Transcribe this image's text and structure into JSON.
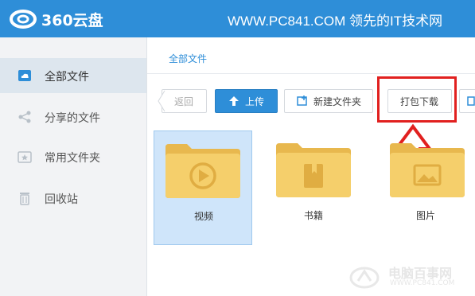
{
  "header": {
    "app_name": "360云盘",
    "watermark": "WWW.PC841.COM 领先的IT技术网",
    "bg_color": "#2e8ed8"
  },
  "sidebar": {
    "items": [
      {
        "label": "全部文件",
        "icon": "cloud-icon",
        "active": true
      },
      {
        "label": "分享的文件",
        "icon": "share-icon",
        "active": false
      },
      {
        "label": "常用文件夹",
        "icon": "star-folder-icon",
        "active": false
      },
      {
        "label": "回收站",
        "icon": "trash-icon",
        "active": false
      }
    ]
  },
  "breadcrumb": "全部文件",
  "toolbar": {
    "back_label": "返回",
    "upload_label": "上传",
    "new_folder_label": "新建文件夹",
    "download_label": "打包下载"
  },
  "folders": [
    {
      "label": "视频",
      "icon": "video-folder-icon",
      "selected": true
    },
    {
      "label": "书籍",
      "icon": "book-folder-icon",
      "selected": false
    },
    {
      "label": "图片",
      "icon": "image-folder-icon",
      "selected": false
    }
  ],
  "footer_watermark": {
    "title": "电脑百事网",
    "url": "WWW.PC841.COM"
  },
  "colors": {
    "accent": "#2e8ed8",
    "highlight": "#e1201f",
    "folder": "#f5cf6b"
  }
}
